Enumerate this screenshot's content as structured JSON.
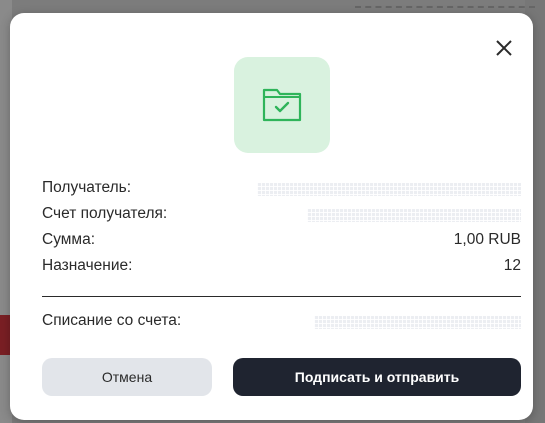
{
  "dialog": {
    "close_icon": "close-icon",
    "status_icon": "folder-check-icon",
    "accent_color": "#2fb45a",
    "icon_tile_color": "#d9f2df"
  },
  "details": {
    "recipient_label": "Получатель:",
    "recipient_account_label": "Счет получателя:",
    "amount_label": "Сумма:",
    "amount_value": "1,00 RUB",
    "purpose_label": "Назначение:",
    "purpose_value": "12",
    "debit_account_label": "Списание со счета:"
  },
  "actions": {
    "cancel_label": "Отмена",
    "submit_label": "Подписать и отправить"
  }
}
